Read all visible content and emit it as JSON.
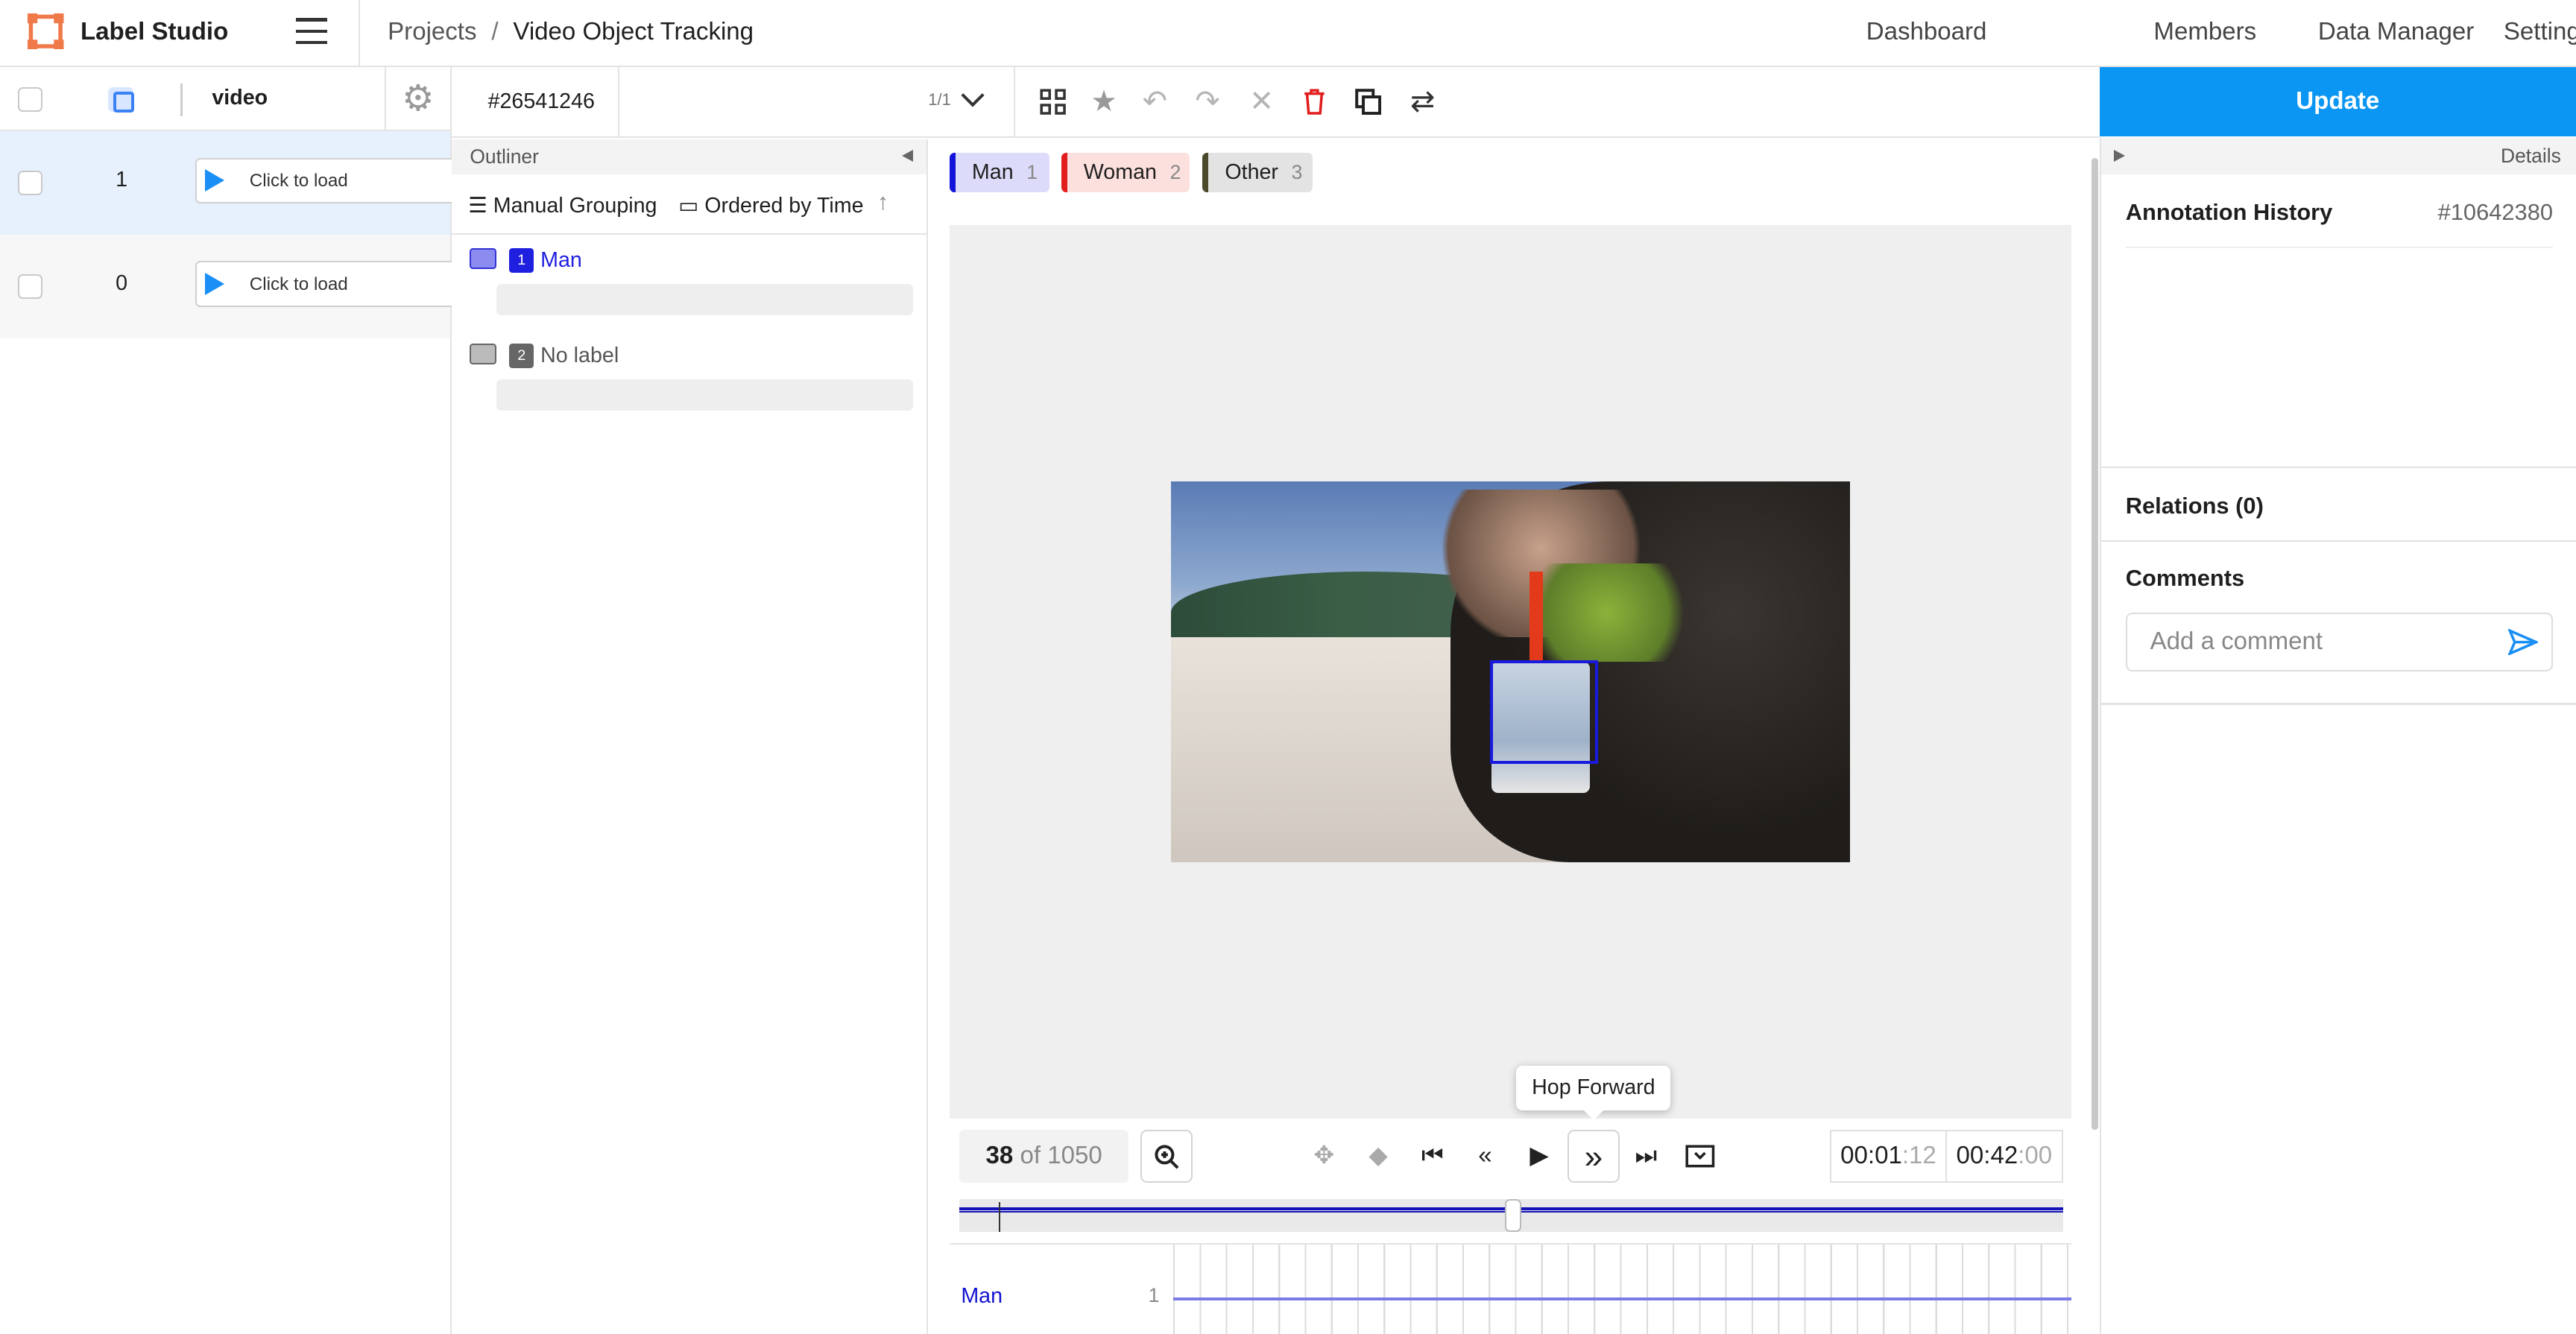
{
  "app": {
    "title": "Label Studio"
  },
  "breadcrumb": {
    "projects": "Projects",
    "separator": "/",
    "current": "Video Object Tracking"
  },
  "nav": [
    "Dashboard",
    "Members",
    "Data Manager",
    "Settings"
  ],
  "data_panel": {
    "column_header": "video",
    "rows": [
      {
        "id": "1",
        "cell": "Click to load",
        "selected": true
      },
      {
        "id": "0",
        "cell": "Click to load",
        "selected": false
      }
    ]
  },
  "task": {
    "id": "#26541246",
    "pager": "1/1"
  },
  "update_button": "Update",
  "outliner": {
    "title": "Outliner",
    "grouping": "Manual Grouping",
    "ordering": "Ordered by Time",
    "regions": [
      {
        "num": "1",
        "label": "Man",
        "color": "#1f1fe0"
      },
      {
        "num": "2",
        "label": "No label",
        "color": "#666666"
      }
    ]
  },
  "labels": [
    {
      "name": "Man",
      "hotkey": "1",
      "color": "#1313d9",
      "bg": "#dcdcfa"
    },
    {
      "name": "Woman",
      "hotkey": "2",
      "color": "#e11d1d",
      "bg": "#fbe0dd"
    },
    {
      "name": "Other",
      "hotkey": "3",
      "color": "#4a4a2a",
      "bg": "#e3e3e3"
    }
  ],
  "player": {
    "frame": "38",
    "frame_of": "of 1050",
    "tooltip": "Hop Forward",
    "current_time": "00:01",
    "current_ms": ":12",
    "total_time": "00:42",
    "total_ms": ":00",
    "position_fraction": 0.036
  },
  "timeline": {
    "track_label": "Man",
    "track_num": "1"
  },
  "details": {
    "header": "Details",
    "annotation_history": "Annotation History",
    "annotation_id": "#10642380",
    "relations": "Relations (0)",
    "comments": "Comments",
    "comment_placeholder": "Add a comment"
  }
}
